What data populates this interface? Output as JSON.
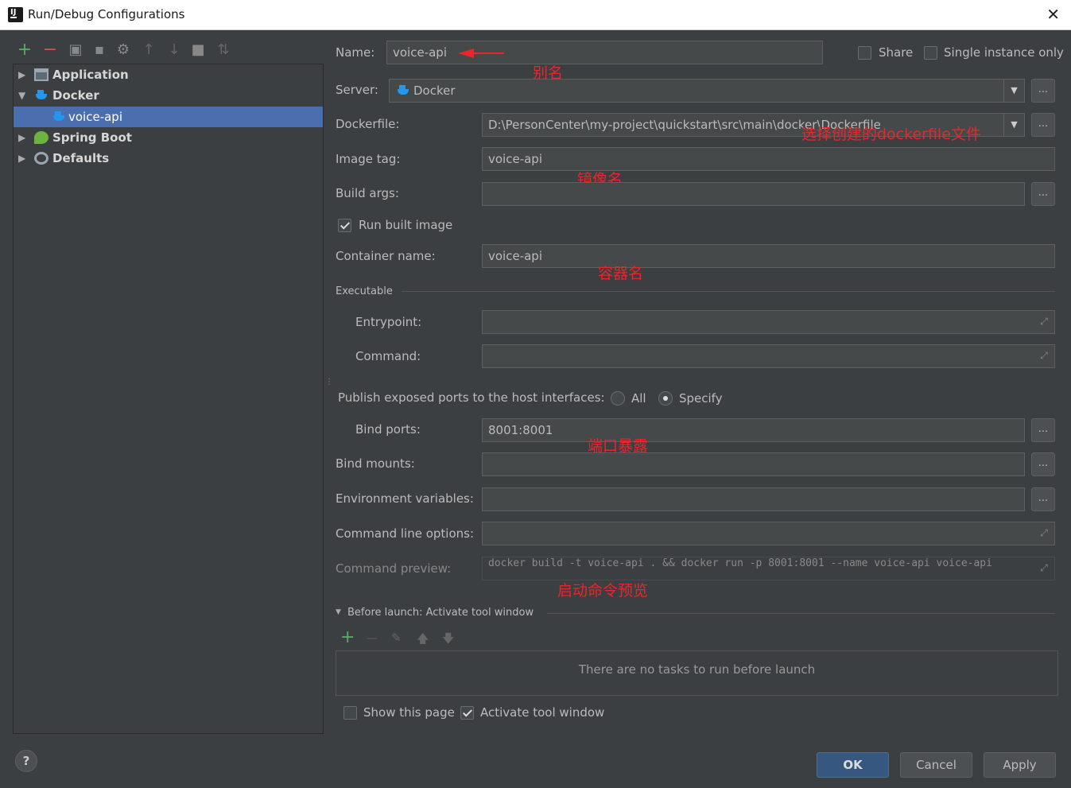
{
  "window": {
    "title": "Run/Debug Configurations",
    "close_glyph": "✕"
  },
  "left_toolbar": {
    "add": "+",
    "remove": "−"
  },
  "tree": {
    "items": [
      {
        "label": "Application",
        "arrow": "▶"
      },
      {
        "label": "Docker",
        "arrow": "▼"
      },
      {
        "label": "voice-api",
        "arrow": ""
      },
      {
        "label": "Spring Boot",
        "arrow": "▶"
      },
      {
        "label": "Defaults",
        "arrow": "▶"
      }
    ]
  },
  "form": {
    "name_label": "Name:",
    "name_value": "voice-api",
    "share_label": "Share",
    "single_instance_label": "Single instance only",
    "server_label": "Server:",
    "server_value": "Docker",
    "dockerfile_label": "Dockerfile:",
    "dockerfile_value": "D:\\PersonCenter\\my-project\\quickstart\\src\\main\\docker\\Dockerfile",
    "image_tag_label": "Image tag:",
    "image_tag_value": "voice-api",
    "build_args_label": "Build args:",
    "build_args_value": "",
    "run_built_image_label": "Run built image",
    "container_name_label": "Container name:",
    "container_name_value": "voice-api",
    "executable_label": "Executable",
    "entrypoint_label": "Entrypoint:",
    "command_label": "Command:",
    "publish_label": "Publish exposed ports to the host interfaces:",
    "radio_all": "All",
    "radio_specify": "Specify",
    "bind_ports_label": "Bind ports:",
    "bind_ports_value": "8001:8001",
    "bind_mounts_label": "Bind mounts:",
    "env_vars_label": "Environment variables:",
    "cmd_options_label": "Command line options:",
    "cmd_preview_label": "Command preview:",
    "cmd_preview_value": "docker build -t voice-api . && docker run -p 8001:8001 --name voice-api voice-api",
    "dots": "...",
    "dropdown_glyph": "▼",
    "expand_glyph": "⤢"
  },
  "annotations": {
    "alias": "别名",
    "dockerfile": "选择创建的dockerfile文件",
    "image": "镜像名",
    "container": "容器名",
    "ports": "端口暴露",
    "preview": "启动命令预览"
  },
  "before_launch": {
    "title": "Before launch: Activate tool window",
    "toggle": "▼",
    "add": "+",
    "remove": "—",
    "edit": "✎",
    "up": "🡅",
    "down": "🡇",
    "empty_text": "There are no tasks to run before launch",
    "show_page_label": "Show this page",
    "activate_label": "Activate tool window"
  },
  "buttons": {
    "ok": "OK",
    "cancel": "Cancel",
    "apply": "Apply",
    "help": "?"
  },
  "state": {
    "share": false,
    "single_instance": false,
    "run_built_image": true,
    "ports_mode": "Specify",
    "show_this_page": false,
    "activate_tool_window": true
  }
}
